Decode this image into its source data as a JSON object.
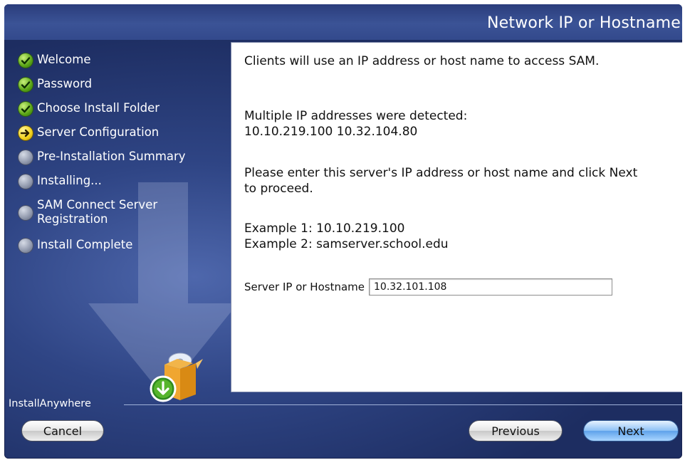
{
  "header": {
    "title": "Network IP or Hostname"
  },
  "steps": [
    {
      "label": "Welcome",
      "status": "done"
    },
    {
      "label": "Password",
      "status": "done"
    },
    {
      "label": "Choose Install Folder",
      "status": "done"
    },
    {
      "label": "Server Configuration",
      "status": "current"
    },
    {
      "label": "Pre-Installation Summary",
      "status": "pending"
    },
    {
      "label": "Installing...",
      "status": "pending"
    },
    {
      "label_line1": "SAM Connect Server",
      "label_line2": "Registration",
      "status": "pending"
    },
    {
      "label": "Install Complete",
      "status": "pending"
    }
  ],
  "content": {
    "intro": "Clients will use an IP address or host name to access SAM.",
    "detected_heading": "Multiple IP addresses were detected:",
    "detected_ips": "10.10.219.100 10.32.104.80",
    "instruction": "Please enter this server's IP address or host name and click Next to proceed.",
    "example1": "Example 1: 10.10.219.100",
    "example2": "Example 2: samserver.school.edu",
    "field_label": "Server IP or Hostname",
    "field_value": "10.32.101.108"
  },
  "footer": {
    "brand": "InstallAnywhere",
    "cancel_label": "Cancel",
    "previous_label": "Previous",
    "next_label": "Next"
  },
  "colors": {
    "background": "#2f4585",
    "step_done": "#5aa516",
    "step_current": "#f2d11b",
    "step_pending": "#8f97ab",
    "next_button": "#5ea2ea"
  },
  "icons": {
    "done": "checkmark-icon",
    "current": "arrow-right-icon",
    "pending": "pending-dot-icon",
    "box": "installer-box-icon"
  }
}
